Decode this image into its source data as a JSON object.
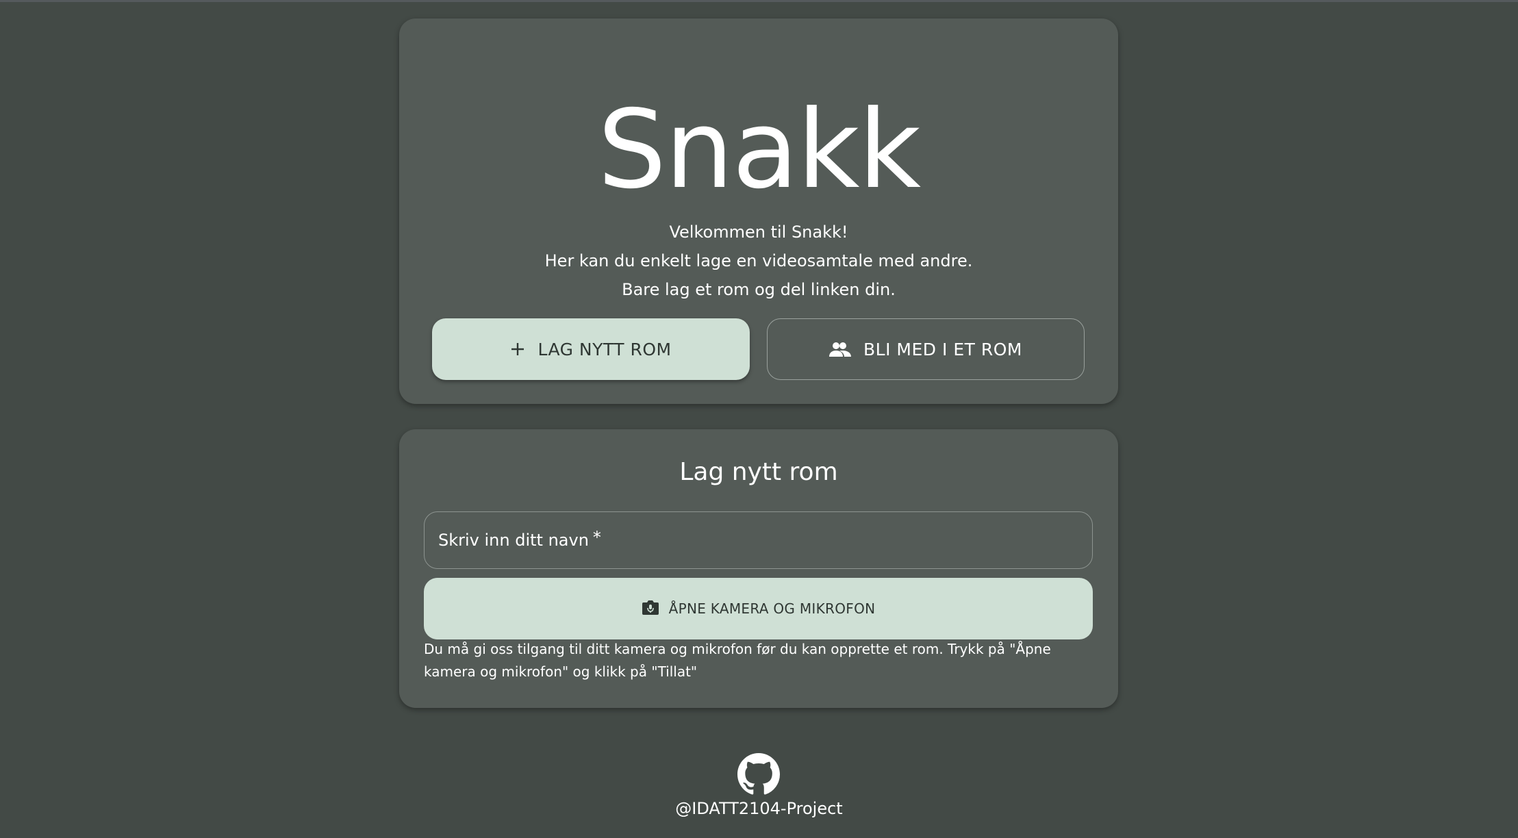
{
  "hero": {
    "title": "Snakk",
    "welcome_lines": [
      "Velkommen til Snakk!",
      "Her kan du enkelt lage en videosamtale med andre.",
      "Bare lag et rom og del linken din."
    ],
    "create_button": {
      "label": "LAG NYTT ROM",
      "icon": "plus-icon"
    },
    "join_button": {
      "label": "BLI MED I ET ROM",
      "icon": "people-icon"
    }
  },
  "create_room": {
    "title": "Lag nytt rom",
    "name_field": {
      "placeholder": "Skriv inn ditt navn",
      "required_marker": "*",
      "value": ""
    },
    "media_button": {
      "label": "ÅPNE KAMERA OG MIKROFON",
      "icon": "camera-mic-icon"
    },
    "help_text": "Du må gi oss tilgang til ditt kamera og mikrofon før du kan opprette et rom. Trykk på \"Åpne kamera og mikrofon\" og klikk på \"Tillat\""
  },
  "footer": {
    "icon": "github-icon",
    "handle": "@IDATT2104-Project"
  },
  "colors": {
    "background": "#434a46",
    "card": "#545b57",
    "accent": "#cfe0d5",
    "accent_text": "#2f3733"
  }
}
